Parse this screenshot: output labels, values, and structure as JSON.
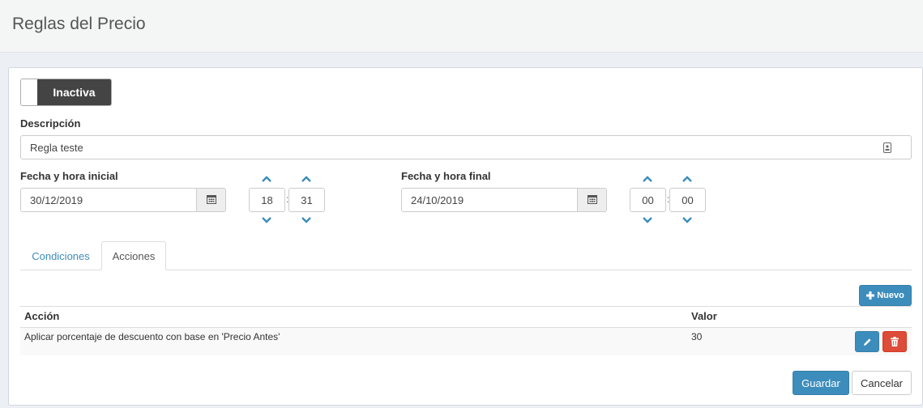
{
  "page": {
    "title": "Reglas del Precio"
  },
  "form": {
    "status_toggle": "Inactiva",
    "description_label": "Descripción",
    "description_value": "Regla teste",
    "start": {
      "label": "Fecha y hora inicial",
      "date": "30/12/2019",
      "hour": "18",
      "minute": "31"
    },
    "end": {
      "label": "Fecha y hora final",
      "date": "24/10/2019",
      "hour": "00",
      "minute": "00"
    },
    "time_separator": ":"
  },
  "tabs": [
    {
      "label": "Condiciones",
      "active": false
    },
    {
      "label": "Acciones",
      "active": true
    }
  ],
  "actions": {
    "new_button": "Nuevo",
    "columns": [
      "Acción",
      "Valor"
    ],
    "rows": [
      {
        "accion": "Aplicar porcentaje de descuento con base en 'Precio Antes'",
        "valor": "30"
      }
    ]
  },
  "footer": {
    "save": "Guardar",
    "cancel": "Cancelar"
  },
  "icons": {
    "calendar": "calendar-icon",
    "chevron_up": "chevron-up-icon",
    "chevron_down": "chevron-down-icon",
    "plus": "plus-icon",
    "pencil": "pencil-icon",
    "trash": "trash-icon",
    "field_addon": "contact-card-icon"
  },
  "colors": {
    "primary": "#3c8dbc",
    "danger": "#dd4b39",
    "toggle_dark": "#444444"
  }
}
